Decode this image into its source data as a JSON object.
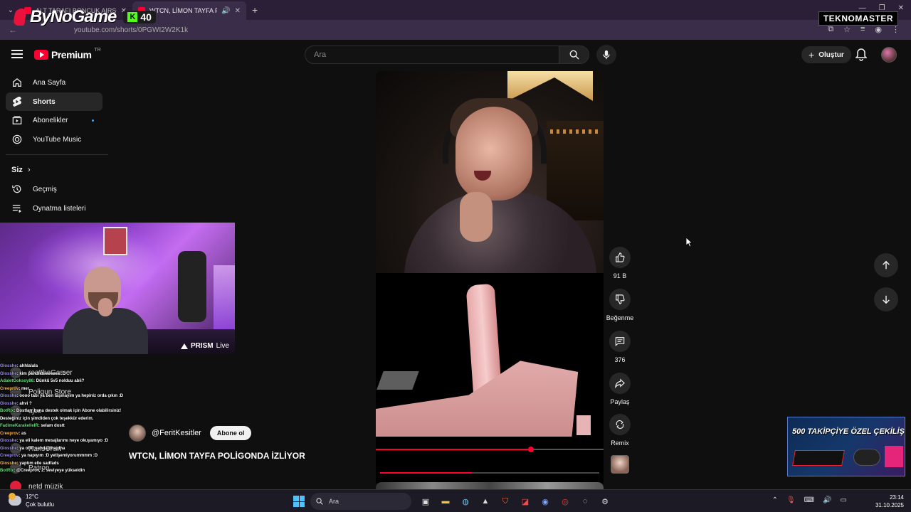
{
  "browser": {
    "tabs": [
      {
        "title": "ALT TARAFI BONCUK AIRSOFT 3",
        "active": false
      },
      {
        "title": "WTCN, LİMON TAYFA POLİGONDA",
        "active": true
      }
    ],
    "url": "youtube.com/shorts/0PGWI2W2K1k"
  },
  "overlay": {
    "brand": "ByNoGame",
    "kick_count": "40",
    "teknomaster": "TEKNOMASTER"
  },
  "header": {
    "logo": "Premium",
    "region": "TR",
    "search_placeholder": "Ara",
    "create_label": "Oluştur"
  },
  "sidebar": {
    "items": [
      {
        "label": "Ana Sayfa",
        "icon": "home-icon"
      },
      {
        "label": "Shorts",
        "icon": "shorts-icon",
        "active": true
      },
      {
        "label": "Abonelikler",
        "icon": "subscriptions-icon",
        "dot": true
      },
      {
        "label": "YouTube Music",
        "icon": "music-icon"
      }
    ],
    "you_label": "Siz",
    "you_items": [
      {
        "label": "Geçmiş",
        "icon": "history-icon"
      },
      {
        "label": "Oynatma listeleri",
        "icon": "playlists-icon"
      }
    ]
  },
  "webcam": {
    "brand": "PRISM",
    "suffix": "Live"
  },
  "subscriptions": [
    {
      "name": "roottheGamer"
    },
    {
      "name": "Poligun Store"
    },
    {
      "name": "ajce"
    },
    {
      "name": "HansCrow"
    },
    {
      "name": "Patron"
    },
    {
      "name": "netd müzik"
    }
  ],
  "chat": [
    {
      "user": "Glosshe",
      "msg": ": ahhlalala"
    },
    {
      "user": "Glosshe",
      "msg": ": kim pendikteeeeeee :D"
    },
    {
      "user": "AdaletGoksoy86",
      "msg": ": Dünkü 5v5 nolduu abii?"
    },
    {
      "user": "Creeprov",
      "msg": ": mer"
    },
    {
      "user": "Glosshe",
      "msg": ": oooo tabi ya ben taşınayım ya hepiniz orda çıkın :D"
    },
    {
      "user": "Glosshe",
      "msg": ": ahvi ?"
    },
    {
      "user": "BotRix",
      "msg": ": Dostlarr bana destek olmak için Abone olabilirsiniz!"
    },
    {
      "user": "",
      "msg": "Desteğiniz için şimdiden çok teşekkür ederim."
    },
    {
      "user": "FadimeKarakelleIR",
      "msg": ": selam dostt"
    },
    {
      "user": "Creeprov",
      "msg": ": as"
    },
    {
      "user": "Glosshe",
      "msg": ": ya eli kalem mesajlarımı neye okuyamıyo :D"
    },
    {
      "user": "Glosshe",
      "msg": ": ya offff uahdajdhajdha"
    },
    {
      "user": "Creeprov",
      "msg": ": ya napıyım :D yetişemiyorummmm :D"
    },
    {
      "user": "Glosshe",
      "msg": ": yaptım elle sadfads"
    },
    {
      "user": "BotRix",
      "msg": ": @Creeprov, 2. seviyeye yükseldin"
    }
  ],
  "short": {
    "channel": "@FeritKesitler",
    "subscribe_label": "Abone ol",
    "title": "WTCN, LİMON TAYFA POLİGONDA İZLİYOR",
    "progress": 0.68,
    "progress2": 0.42
  },
  "actions": {
    "like_label": "91 B",
    "dislike_label": "Beğenme",
    "comments_label": "376",
    "share_label": "Paylaş",
    "remix_label": "Remix"
  },
  "promo": {
    "text": "500 TAKİPÇİYE ÖZEL ÇEKİLİŞ"
  },
  "taskbar": {
    "temp": "12°C",
    "weather": "Çok bulutlu",
    "search_label": "Ara",
    "time": "23:14",
    "date": "31.10.2025"
  }
}
